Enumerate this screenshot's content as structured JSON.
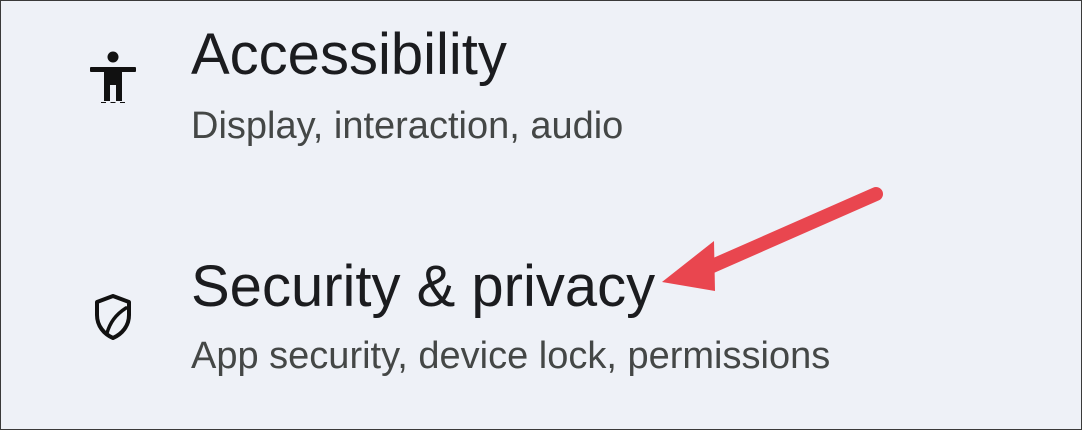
{
  "settings": {
    "items": [
      {
        "title": "Accessibility",
        "subtitle": "Display, interaction, audio",
        "icon": "accessibility-icon"
      },
      {
        "title": "Security & privacy",
        "subtitle": "App security, device lock, permissions",
        "icon": "shield-icon"
      }
    ]
  },
  "annotation": {
    "arrow_color": "#e9464f"
  }
}
